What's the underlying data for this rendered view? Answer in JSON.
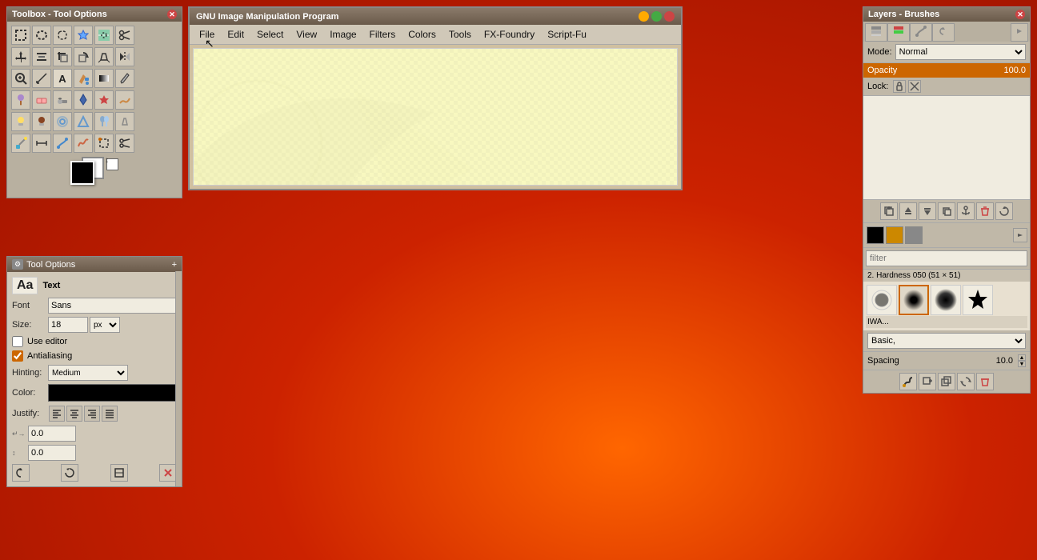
{
  "app": {
    "title": "GNU Image Manipulation Program",
    "bg_color": "#cc3300"
  },
  "toolbox": {
    "title": "Toolbox - Tool Options",
    "tools": [
      [
        "rect-select",
        "ellipse-select",
        "lasso-select",
        "fuzzy-select",
        "select-by-color",
        "scissors-select"
      ],
      [
        "move",
        "align",
        "crop",
        "rotate",
        "perspective",
        "flip"
      ],
      [
        "zoom",
        "measure",
        "text",
        "bucket-fill",
        "blend",
        "pencil"
      ],
      [
        "brush",
        "eraser",
        "airbrush",
        "ink",
        "heal",
        "smudge"
      ],
      [
        "dodge",
        "burn",
        "blur",
        "sharpen",
        "clone",
        "perspective-clone"
      ],
      [
        "color-picker",
        "measure2",
        "paths",
        "freehand",
        "modify-selection",
        "iscissors"
      ]
    ],
    "fg_color": "#000000",
    "bg_color": "#ffffff"
  },
  "tool_options": {
    "title": "Tool Options",
    "section": "Text",
    "font_label": "Font",
    "font_value": "Sans",
    "size_label": "Size:",
    "size_value": "18",
    "unit_value": "px",
    "use_editor_label": "Use editor",
    "antialiasing_label": "Antialiasing",
    "hinting_label": "Hinting:",
    "hinting_value": "Medium",
    "color_label": "Color:",
    "justify_label": "Justify:",
    "indent_value": "0.0",
    "line_spacing_value": "0.0"
  },
  "menubar": {
    "items": [
      "File",
      "Edit",
      "Select",
      "View",
      "Image",
      "Filters",
      "Colors",
      "Tools",
      "FX-Foundry",
      "Script-Fu"
    ]
  },
  "layers_panel": {
    "title": "Layers - Brushes",
    "tabs": [
      "layers",
      "channels",
      "paths",
      "history"
    ],
    "mode_label": "Mode:",
    "mode_value": "Normal",
    "opacity_label": "Opacity",
    "opacity_value": "100.0",
    "lock_label": "Lock:",
    "filter_placeholder": "filter",
    "brush_info": "2. Hardness 050 (51 × 51)",
    "brush_category": "Basic,",
    "spacing_label": "Spacing",
    "spacing_value": "10.0"
  }
}
